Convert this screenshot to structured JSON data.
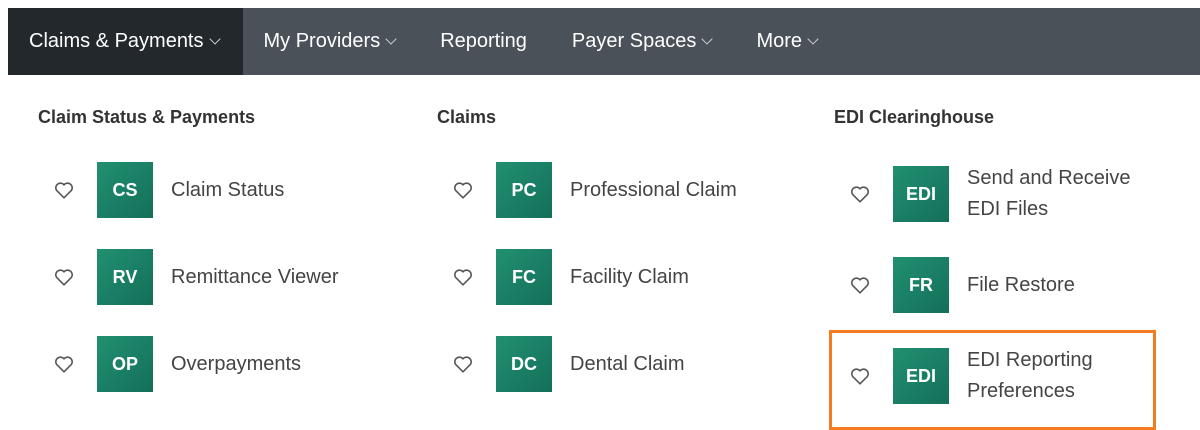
{
  "colors": {
    "navbar": "#4a5159",
    "nav_active": "#23282d",
    "badge": "#1a7f66",
    "highlight": "#f47b20"
  },
  "nav": {
    "items": [
      {
        "label": "Claims & Payments",
        "has_dropdown": true,
        "active": true
      },
      {
        "label": "My Providers",
        "has_dropdown": true
      },
      {
        "label": "Reporting",
        "has_dropdown": false
      },
      {
        "label": "Payer Spaces",
        "has_dropdown": true
      },
      {
        "label": "More",
        "has_dropdown": true
      }
    ]
  },
  "columns": [
    {
      "heading": "Claim Status & Payments",
      "items": [
        {
          "badge": "CS",
          "label": "Claim Status",
          "icon": "heart-outline-icon"
        },
        {
          "badge": "RV",
          "label": "Remittance Viewer",
          "icon": "heart-outline-icon"
        },
        {
          "badge": "OP",
          "label": "Overpayments",
          "icon": "heart-outline-icon"
        }
      ]
    },
    {
      "heading": "Claims",
      "items": [
        {
          "badge": "PC",
          "label": "Professional Claim",
          "icon": "heart-outline-icon"
        },
        {
          "badge": "FC",
          "label": "Facility Claim",
          "icon": "heart-outline-icon"
        },
        {
          "badge": "DC",
          "label": "Dental Claim",
          "icon": "heart-outline-icon"
        }
      ]
    },
    {
      "heading": "EDI Clearinghouse",
      "items": [
        {
          "badge": "EDI",
          "label_line1": "Send and Receive",
          "label_line2": "EDI Files",
          "icon": "heart-outline-icon"
        },
        {
          "badge": "FR",
          "label": "File Restore",
          "icon": "heart-outline-icon"
        },
        {
          "badge": "EDI",
          "label_line1": "EDI Reporting",
          "label_line2": "Preferences",
          "icon": "heart-outline-icon",
          "highlighted": true
        }
      ]
    }
  ]
}
